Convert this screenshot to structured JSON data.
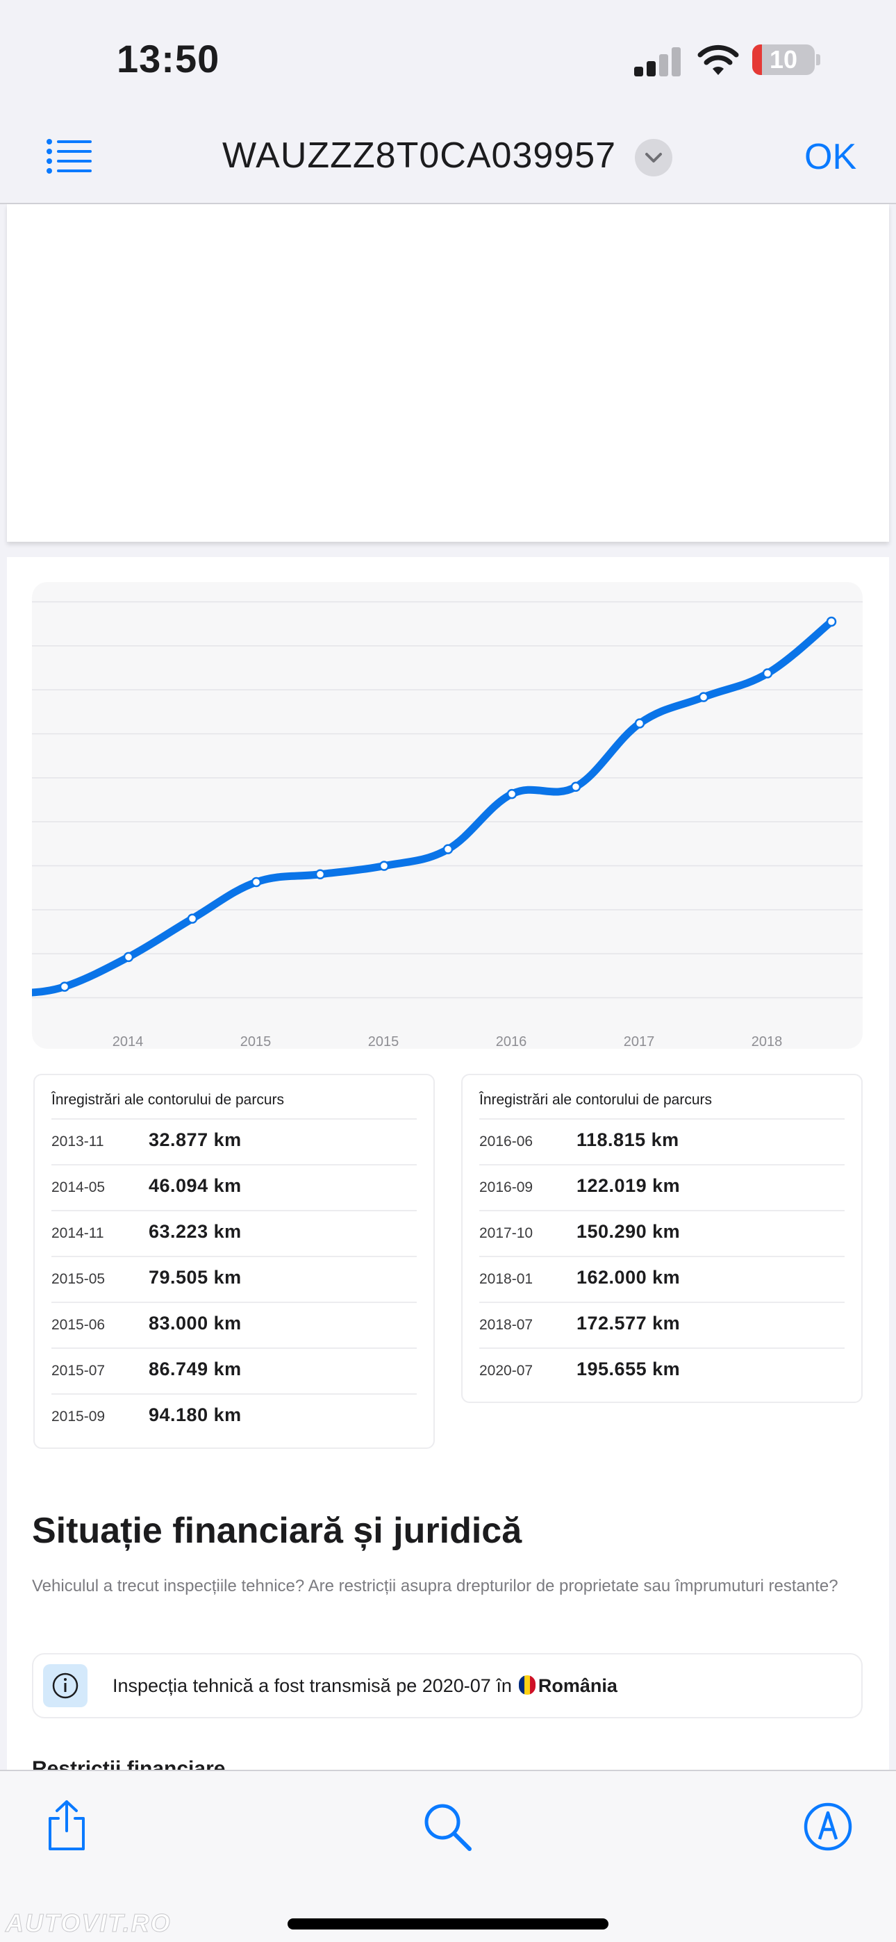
{
  "status_bar": {
    "time": "13:50",
    "battery_level": "10"
  },
  "nav": {
    "title": "WAUZZZ8T0CA039957",
    "ok_label": "OK"
  },
  "chart_data": {
    "type": "line",
    "title": "",
    "xlabel": "",
    "ylabel": "",
    "x_tick_labels": [
      "2014",
      "2015",
      "2015",
      "2016",
      "2017",
      "2018"
    ],
    "series": [
      {
        "x": [
          "2013-11",
          "2014-05",
          "2014-11",
          "2015-05",
          "2015-06",
          "2015-07",
          "2015-09",
          "2016-06",
          "2016-09",
          "2017-10",
          "2018-01",
          "2018-07",
          "2020-07"
        ],
        "values": [
          32877,
          46094,
          63223,
          79505,
          83000,
          86749,
          94180,
          118815,
          122019,
          150290,
          162000,
          172577,
          195655
        ]
      }
    ],
    "grid": true,
    "color": "#0a74e8"
  },
  "mileage": {
    "left": {
      "title": "Înregistrări ale contorului de parcurs",
      "rows": [
        {
          "date": "2013-11",
          "km": "32.877 km"
        },
        {
          "date": "2014-05",
          "km": "46.094 km"
        },
        {
          "date": "2014-11",
          "km": "63.223 km"
        },
        {
          "date": "2015-05",
          "km": "79.505 km"
        },
        {
          "date": "2015-06",
          "km": "83.000 km"
        },
        {
          "date": "2015-07",
          "km": "86.749 km"
        },
        {
          "date": "2015-09",
          "km": "94.180 km"
        }
      ]
    },
    "right": {
      "title": "Înregistrări ale contorului de parcurs",
      "rows": [
        {
          "date": "2016-06",
          "km": "118.815 km"
        },
        {
          "date": "2016-09",
          "km": "122.019 km"
        },
        {
          "date": "2017-10",
          "km": "150.290 km"
        },
        {
          "date": "2018-01",
          "km": "162.000 km"
        },
        {
          "date": "2018-07",
          "km": "172.577 km"
        },
        {
          "date": "2020-07",
          "km": "195.655 km"
        }
      ]
    }
  },
  "financial": {
    "title": "Situație financiară și juridică",
    "description": "Vehiculul a trecut inspecțiile tehnice? Are restricții asupra drepturilor de proprietate sau împrumuturi restante?",
    "inspection_text": "Inspecția tehnică a fost transmisă pe 2020-07 în",
    "country": "România",
    "restrictions_label": "Restricții financiare"
  },
  "watermark": "AUTOVIT.RO"
}
